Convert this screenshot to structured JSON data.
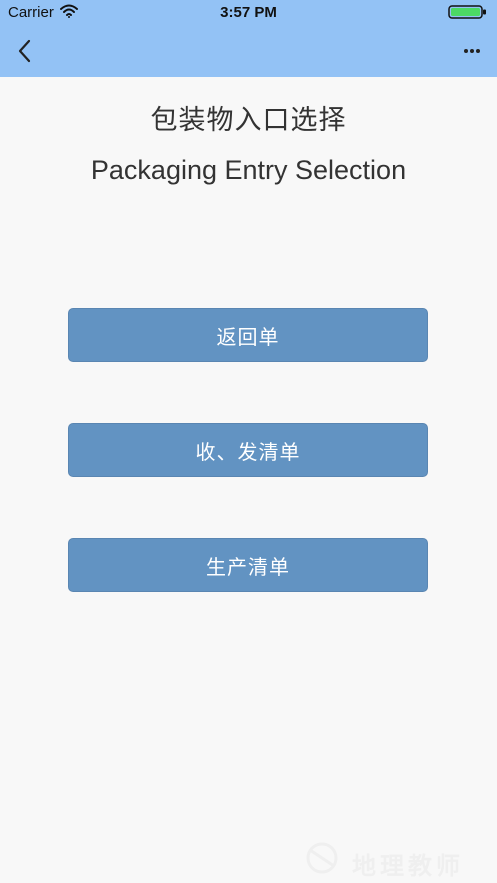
{
  "status_bar": {
    "carrier": "Carrier",
    "time": "3:57 PM",
    "battery_icon": "battery-full-icon",
    "wifi_icon": "wifi-icon"
  },
  "nav": {
    "back_icon": "chevron-left-icon",
    "more_icon": "ellipsis-icon"
  },
  "header": {
    "title_zh": "包装物入口选择",
    "title_en": "Packaging Entry Selection"
  },
  "buttons": [
    {
      "label": "返回单"
    },
    {
      "label": "收、发清单"
    },
    {
      "label": "生产清单"
    }
  ],
  "watermark": {
    "text": "地理教师"
  },
  "colors": {
    "nav_background": "#93c2f5",
    "button_background": "#6293c2",
    "page_background": "#f8f8f8",
    "text_color": "#333333"
  }
}
